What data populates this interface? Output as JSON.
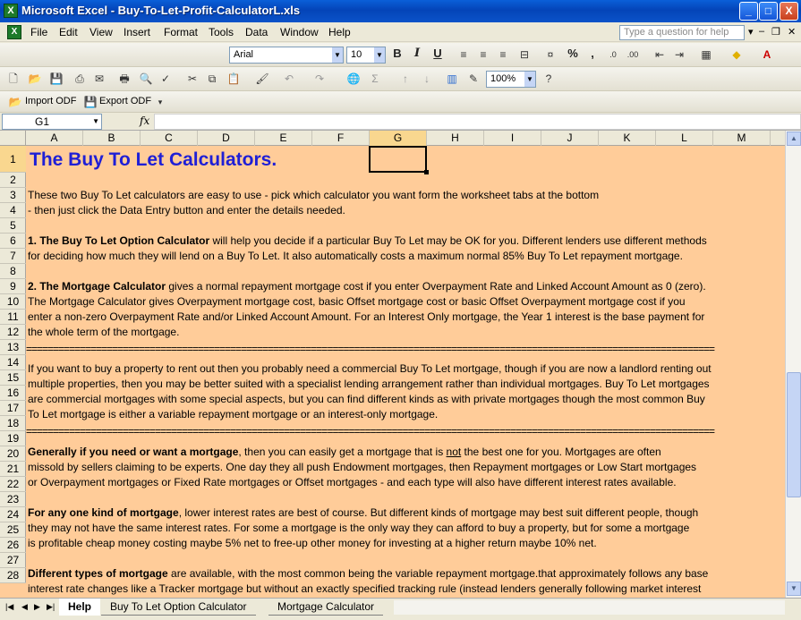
{
  "window": {
    "title": "Microsoft Excel - Buy-To-Let-Profit-CalculatorL.xls",
    "buttons": {
      "minimize": "_",
      "maximize": "□",
      "close": "X"
    }
  },
  "menu": {
    "items": [
      "File",
      "Edit",
      "View",
      "Insert",
      "Format",
      "Tools",
      "Data",
      "Window",
      "Help"
    ],
    "question_placeholder": "Type a question for help"
  },
  "format_toolbar": {
    "font": "Arial",
    "size": "10",
    "bold": "B",
    "italic": "I",
    "underline": "U",
    "percent": "%",
    "comma": ","
  },
  "standard_toolbar": {
    "zoom": "100%"
  },
  "odf_toolbar": {
    "import_label": "Import ODF",
    "export_label": "Export ODF"
  },
  "formula_bar": {
    "cell_ref": "G1",
    "fx": "fx",
    "value": ""
  },
  "columns": [
    "A",
    "B",
    "C",
    "D",
    "E",
    "F",
    "G",
    "H",
    "I",
    "J",
    "K",
    "L",
    "M"
  ],
  "active_column": "G",
  "rows": [
    "1",
    "2",
    "3",
    "4",
    "5",
    "6",
    "7",
    "8",
    "9",
    "10",
    "11",
    "12",
    "13",
    "14",
    "15",
    "16",
    "17",
    "18",
    "19",
    "20",
    "21",
    "22",
    "23",
    "24",
    "25",
    "26",
    "27",
    "28"
  ],
  "sheet": {
    "title": "The Buy To Let Calculators.",
    "r3": "These two Buy To Let calculators are easy to use - pick which calculator you want form the worksheet tabs at the bottom",
    "r4": " - then just click the Data Entry button and enter the details needed.",
    "r6_bold": "1. The Buy To Let Option Calculator",
    "r6_rest": " will help you decide if a particular Buy To Let may be OK for you. Different lenders use different methods",
    "r7": "for deciding how much they will lend on a Buy To Let. It also automatically costs a maximum normal 85% Buy To Let repayment mortgage.",
    "r9_bold": "2. The Mortgage Calculator",
    "r9_rest": " gives a normal repayment mortgage cost if you enter Overpayment Rate and Linked Account Amount as 0 (zero).",
    "r10": "The Mortgage Calculator gives Overpayment mortgage cost, basic Offset mortgage cost or basic Offset Overpayment mortgage cost if you",
    "r11": "enter a non-zero Overpayment Rate and/or Linked Account Amount. For an Interest Only mortgage, the Year 1 interest is the base payment for",
    "r12": "the whole term of the mortgage.",
    "separator": "================================================================================================================================",
    "r14": "If you want to buy a property to rent out then you probably need a commercial Buy To Let mortgage, though if you are now a landlord renting out",
    "r15": "multiple properties, then you may be better suited with a specialist lending arrangement rather than individual mortgages. Buy To Let mortgages",
    "r16": "are commercial mortgages with some special aspects, but you can find different kinds as with private mortgages though the most common Buy",
    "r17": "To Let mortgage is either a variable repayment mortgage or an interest-only mortgage.",
    "r19_bold": "Generally if you need or want a mortgage",
    "r19_mid": ", then you can easily get a mortgage that is ",
    "r19_u": "not",
    "r19_end": " the best one for you. Mortgages are often",
    "r20": "missold by sellers claiming to be experts. One day they all push Endowment mortgages, then Repayment mortgages or Low Start mortgages",
    "r21": "or Overpayment mortgages or Fixed Rate mortgages or Offset mortgages - and each type will also have different interest rates available.",
    "r23_bold": "For any one kind of mortgage",
    "r23_rest": ", lower interest rates are best of course. But different kinds of mortgage may best suit different people, though",
    "r24": "they may not have the same interest rates. For some a mortgage is the only way they can afford to buy a property, but for some a mortgage",
    "r25": "is profitable cheap money costing maybe 5% net to free-up other money for investing at a higher return maybe 10% net.",
    "r27_bold": "Different types of mortgage",
    "r27_rest": " are available, with the most common being the variable repayment mortgage.that approximately follows any base",
    "r28": "interest rate changes like a Tracker mortgage but without an exactly specified tracking rule (instead lenders generally following market interest"
  },
  "tabs": [
    "Help",
    "Buy To Let Option Calculator",
    "Mortgage Calculator"
  ],
  "colors": {
    "sheet_bg": "#ffcc99",
    "title_blue": "#1f1fd6",
    "titlebar": "#0a5fd8"
  }
}
